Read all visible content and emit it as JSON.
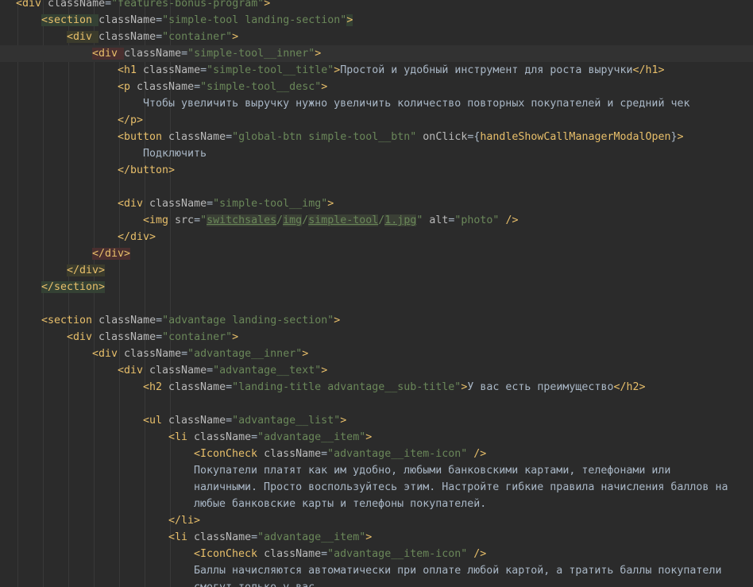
{
  "lines": [
    {
      "p": [
        [
          "tag",
          "<div "
        ],
        [
          "attr",
          "className"
        ],
        [
          "txt",
          "="
        ],
        [
          "str",
          "\"features-bonus-program\""
        ],
        [
          "tag",
          ">"
        ]
      ]
    },
    {
      "p": [
        [
          "tag",
          "<section "
        ],
        [
          "attr",
          "className"
        ],
        [
          "txt",
          "="
        ],
        [
          "str",
          "\"simple-tool landing-section\""
        ],
        [
          "tag",
          ">"
        ]
      ]
    },
    {
      "p": [
        [
          "tag",
          "<div "
        ],
        [
          "attr",
          "className"
        ],
        [
          "txt",
          "="
        ],
        [
          "str",
          "\"container\""
        ],
        [
          "tag",
          ">"
        ]
      ]
    },
    {
      "p": [
        [
          "tag",
          "<div "
        ],
        [
          "attr",
          "className"
        ],
        [
          "txt",
          "="
        ],
        [
          "str",
          "\"simple-tool__inner\""
        ],
        [
          "tag",
          ">"
        ]
      ]
    },
    {
      "p": [
        [
          "tag",
          "<h1 "
        ],
        [
          "attr",
          "className"
        ],
        [
          "txt",
          "="
        ],
        [
          "str",
          "\"simple-tool__title\""
        ],
        [
          "tag",
          ">"
        ],
        [
          "txt",
          "Простой и удобный инструмент для роста выручки"
        ],
        [
          "tag",
          "</h1>"
        ]
      ]
    },
    {
      "p": [
        [
          "tag",
          "<p "
        ],
        [
          "attr",
          "className"
        ],
        [
          "txt",
          "="
        ],
        [
          "str",
          "\"simple-tool__desc\""
        ],
        [
          "tag",
          ">"
        ]
      ]
    },
    {
      "p": [
        [
          "txt",
          "Чтобы увеличить выручку нужно увеличить количество повторных покупателей и средний чек"
        ]
      ]
    },
    {
      "p": [
        [
          "tag",
          "</p>"
        ]
      ]
    },
    {
      "p": [
        [
          "tag",
          "<button "
        ],
        [
          "attr",
          "className"
        ],
        [
          "txt",
          "="
        ],
        [
          "str",
          "\"global-btn simple-tool__btn\""
        ],
        [
          "attr",
          " onClick"
        ],
        [
          "txt",
          "={"
        ],
        [
          "fn",
          "handleShowCallManagerModalOpen"
        ],
        [
          "txt",
          "}"
        ],
        [
          "tag",
          ">"
        ]
      ]
    },
    {
      "p": [
        [
          "txt",
          "Подключить"
        ]
      ]
    },
    {
      "p": [
        [
          "tag",
          "</button>"
        ]
      ]
    },
    {
      "p": []
    },
    {
      "p": [
        [
          "tag",
          "<div "
        ],
        [
          "attr",
          "className"
        ],
        [
          "txt",
          "="
        ],
        [
          "str",
          "\"simple-tool__img\""
        ],
        [
          "tag",
          ">"
        ]
      ]
    },
    {
      "p": [
        [
          "tag",
          "<img "
        ],
        [
          "attr",
          "src"
        ],
        [
          "txt",
          "="
        ],
        [
          "str",
          "\""
        ],
        [
          "path",
          "switchsales"
        ],
        [
          "str",
          "/"
        ],
        [
          "path",
          "img"
        ],
        [
          "str",
          "/"
        ],
        [
          "path",
          "simple-tool"
        ],
        [
          "str",
          "/"
        ],
        [
          "path",
          "1.jpg"
        ],
        [
          "str",
          "\""
        ],
        [
          "attr",
          " alt"
        ],
        [
          "txt",
          "="
        ],
        [
          "str",
          "\"photo\""
        ],
        [
          "tag",
          " />"
        ]
      ]
    },
    {
      "p": [
        [
          "tag",
          "</div>"
        ]
      ]
    },
    {
      "p": [
        [
          "tag",
          "</div>"
        ]
      ]
    },
    {
      "p": [
        [
          "tag",
          "</div>"
        ]
      ]
    },
    {
      "p": [
        [
          "tag",
          "</section>"
        ]
      ]
    },
    {
      "p": []
    },
    {
      "p": [
        [
          "tag",
          "<section "
        ],
        [
          "attr",
          "className"
        ],
        [
          "txt",
          "="
        ],
        [
          "str",
          "\"advantage landing-section\""
        ],
        [
          "tag",
          ">"
        ]
      ]
    },
    {
      "p": [
        [
          "tag",
          "<div "
        ],
        [
          "attr",
          "className"
        ],
        [
          "txt",
          "="
        ],
        [
          "str",
          "\"container\""
        ],
        [
          "tag",
          ">"
        ]
      ]
    },
    {
      "p": [
        [
          "tag",
          "<div "
        ],
        [
          "attr",
          "className"
        ],
        [
          "txt",
          "="
        ],
        [
          "str",
          "\"advantage__inner\""
        ],
        [
          "tag",
          ">"
        ]
      ]
    },
    {
      "p": [
        [
          "tag",
          "<div "
        ],
        [
          "attr",
          "className"
        ],
        [
          "txt",
          "="
        ],
        [
          "str",
          "\"advantage__text\""
        ],
        [
          "tag",
          ">"
        ]
      ]
    },
    {
      "p": [
        [
          "tag",
          "<h2 "
        ],
        [
          "attr",
          "className"
        ],
        [
          "txt",
          "="
        ],
        [
          "str",
          "\"landing-title advantage__sub-title\""
        ],
        [
          "tag",
          ">"
        ],
        [
          "txt",
          "У вас есть преимущество"
        ],
        [
          "tag",
          "</h2>"
        ]
      ]
    },
    {
      "p": []
    },
    {
      "p": [
        [
          "tag",
          "<ul "
        ],
        [
          "attr",
          "className"
        ],
        [
          "txt",
          "="
        ],
        [
          "str",
          "\"advantage__list\""
        ],
        [
          "tag",
          ">"
        ]
      ]
    },
    {
      "p": [
        [
          "tag",
          "<li "
        ],
        [
          "attr",
          "className"
        ],
        [
          "txt",
          "="
        ],
        [
          "str",
          "\"advantage__item\""
        ],
        [
          "tag",
          ">"
        ]
      ]
    },
    {
      "p": [
        [
          "tag",
          "<IconCheck "
        ],
        [
          "attr",
          "className"
        ],
        [
          "txt",
          "="
        ],
        [
          "str",
          "\"advantage__item-icon\""
        ],
        [
          "tag",
          " />"
        ]
      ]
    },
    {
      "p": [
        [
          "txt",
          "Покупатели платят как им удобно, любыми банковскими картами, телефонами или"
        ]
      ]
    },
    {
      "p": [
        [
          "txt",
          "наличными. Просто воспользуйтесь этим. Настройте гибкие правила начисления баллов на"
        ]
      ]
    },
    {
      "p": [
        [
          "txt",
          "любые банковские карты и телефоны покупателей."
        ]
      ]
    },
    {
      "p": [
        [
          "tag",
          "</li>"
        ]
      ]
    },
    {
      "p": [
        [
          "tag",
          "<li "
        ],
        [
          "attr",
          "className"
        ],
        [
          "txt",
          "="
        ],
        [
          "str",
          "\"advantage__item\""
        ],
        [
          "tag",
          ">"
        ]
      ]
    },
    {
      "p": [
        [
          "tag",
          "<IconCheck "
        ],
        [
          "attr",
          "className"
        ],
        [
          "txt",
          "="
        ],
        [
          "str",
          "\"advantage__item-icon\""
        ],
        [
          "tag",
          " />"
        ]
      ]
    },
    {
      "p": [
        [
          "txt",
          "Баллы начисляются автоматически при оплате любой картой, а тратить баллы покупатели"
        ]
      ]
    },
    {
      "p": [
        [
          "txt",
          "смогут только у вас."
        ]
      ]
    }
  ]
}
